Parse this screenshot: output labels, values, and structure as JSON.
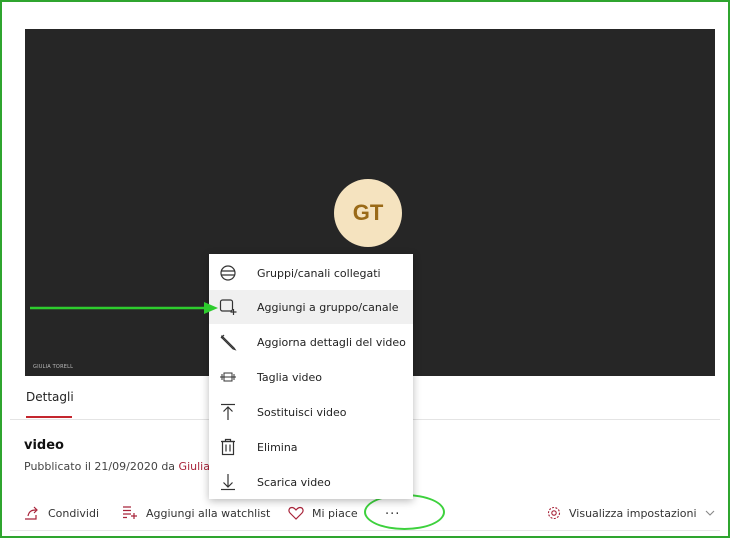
{
  "video_player": {
    "avatar_initials": "GT",
    "caption": "GIULIA TORELL"
  },
  "details": {
    "tab_label": "Dettagli",
    "video_title": "video",
    "published_prefix": "Pubblicato il 21/09/2020 da",
    "author": "Giulia T"
  },
  "actions": {
    "share": "Condividi",
    "watchlist": "Aggiungi alla watchlist",
    "like": "Mi piace",
    "more": "···",
    "settings": "Visualizza impostazioni"
  },
  "context_menu": {
    "items": [
      {
        "label": "Gruppi/canali collegati",
        "icon": "linked-groups-icon"
      },
      {
        "label": "Aggiungi a gruppo/canale",
        "icon": "add-to-group-icon"
      },
      {
        "label": "Aggiorna dettagli del video",
        "icon": "pencil-icon"
      },
      {
        "label": "Taglia video",
        "icon": "trim-icon"
      },
      {
        "label": "Sostituisci video",
        "icon": "replace-icon"
      },
      {
        "label": "Elimina",
        "icon": "trash-icon"
      },
      {
        "label": "Scarica video",
        "icon": "download-icon"
      }
    ],
    "highlighted_index": 1
  },
  "colors": {
    "annotation_green": "#2fa52f",
    "author_link": "#a8243a",
    "tab_accent": "#c4262e",
    "avatar_bg": "#f5e3bf",
    "avatar_fg": "#9a6a17"
  }
}
